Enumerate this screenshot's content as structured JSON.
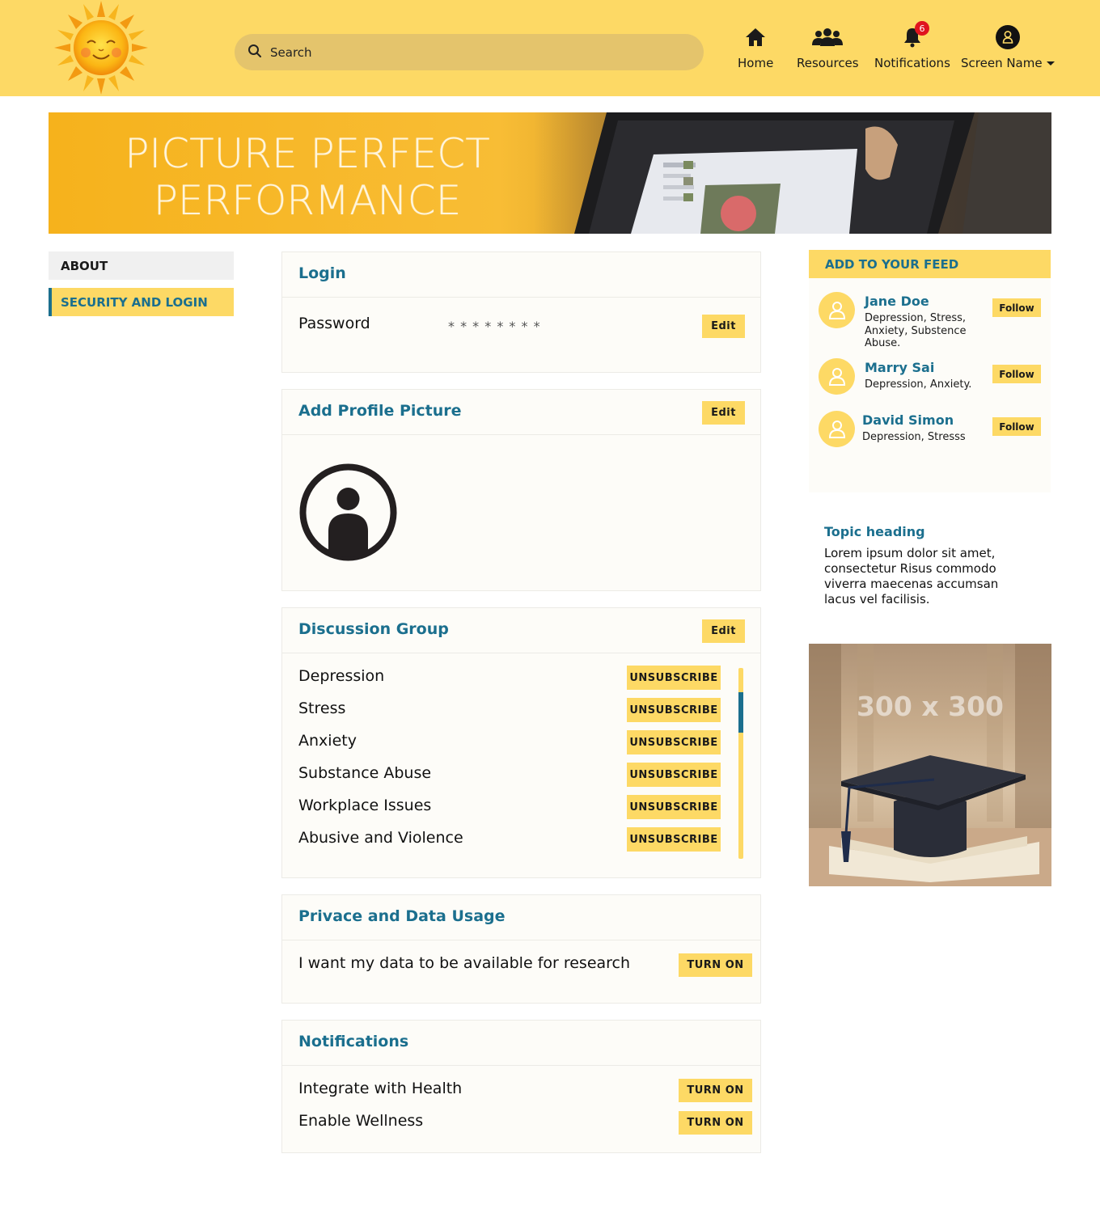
{
  "header": {
    "search_placeholder": "Search",
    "nav": {
      "home": "Home",
      "resources": "Resources",
      "notifications": "Notifications",
      "notifications_count": "6",
      "screen_name": "Screen Name"
    }
  },
  "banner": {
    "line1": "PICTURE PERFECT",
    "line2": "PERFORMANCE"
  },
  "sidebar": {
    "items": [
      {
        "label": "ABOUT"
      },
      {
        "label": "SECURITY AND LOGIN"
      }
    ]
  },
  "login": {
    "title": "Login",
    "password_label": "Password",
    "password_mask": "* * * * * * * *",
    "edit": "Edit"
  },
  "profile_picture": {
    "title": "Add Profile Picture",
    "edit": "Edit"
  },
  "discussion": {
    "title": "Discussion Group",
    "edit": "Edit",
    "groups": [
      {
        "name": "Depression",
        "action": "UNSUBSCRIBE"
      },
      {
        "name": "Stress",
        "action": "UNSUBSCRIBE"
      },
      {
        "name": "Anxiety",
        "action": "UNSUBSCRIBE"
      },
      {
        "name": "Substance Abuse",
        "action": "UNSUBSCRIBE"
      },
      {
        "name": "Workplace Issues",
        "action": "UNSUBSCRIBE"
      },
      {
        "name": "Abusive and Violence",
        "action": "UNSUBSCRIBE"
      }
    ]
  },
  "privacy": {
    "title": "Privace and Data Usage",
    "rows": [
      {
        "label": "I want my data to be available for research",
        "action": "TURN ON"
      }
    ]
  },
  "notifications": {
    "title": "Notifications",
    "rows": [
      {
        "label": "Integrate with Health",
        "action": "TURN ON"
      },
      {
        "label": "Enable Wellness",
        "action": "TURN ON"
      }
    ]
  },
  "feed": {
    "heading": "ADD TO YOUR FEED",
    "people": [
      {
        "name": "Jane Doe",
        "desc": "Depression, Stress, Anxiety, Substence Abuse.",
        "action": "Follow"
      },
      {
        "name": "Marry Sai",
        "desc": "Depression, Anxiety.",
        "action": "Follow"
      },
      {
        "name": "David Simon",
        "desc": "Depression, Stresss",
        "action": "Follow"
      }
    ]
  },
  "topic": {
    "heading": "Topic heading",
    "body": "Lorem ipsum dolor sit amet, consectetur   Risus commodo viverra maecenas accumsan lacus vel facilisis."
  },
  "ad": {
    "label": "300 x 300"
  },
  "colors": {
    "header_bg": "#fdd965",
    "accent_blue": "#1b6f8e",
    "button_yellow": "#fdd965",
    "badge_red": "#e0141e"
  }
}
